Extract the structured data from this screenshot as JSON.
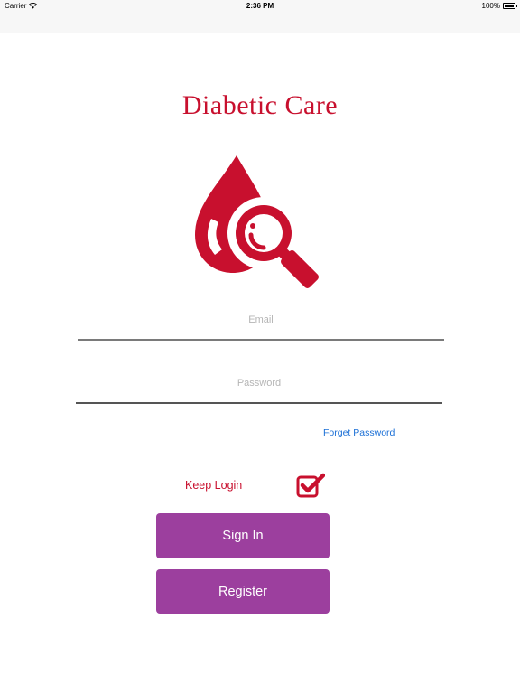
{
  "status_bar": {
    "carrier": "Carrier",
    "time": "2:36 PM",
    "battery": "100%"
  },
  "app": {
    "title": "Diabetic Care",
    "logo_icon": "blood-drop-magnifier-icon",
    "brand_color": "#c8102e"
  },
  "form": {
    "email_placeholder": "Email",
    "email_value": "",
    "password_placeholder": "Password",
    "password_value": "",
    "forget_password_label": "Forget Password",
    "keep_login_label": "Keep Login",
    "keep_login_checked": true,
    "sign_in_label": "Sign In",
    "register_label": "Register",
    "button_color": "#9c3f9e",
    "link_color": "#1a6fd6"
  }
}
